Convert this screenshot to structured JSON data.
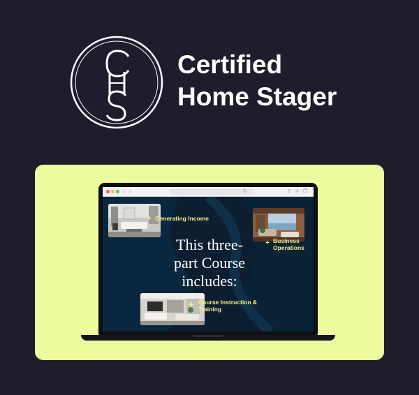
{
  "brand": {
    "logo_letters": "CHS",
    "title_line1": "Certified",
    "title_line2": "Home Stager"
  },
  "colors": {
    "page_background": "#1d1d2c",
    "card_background": "#eefc9f",
    "slide_background": "#0c1e30",
    "feature_text": "#f3f28a",
    "brand_text": "#ffffff"
  },
  "browser": {
    "back_icon": "chevron-left-icon",
    "forward_icon": "chevron-right-icon",
    "reload_icon": "reload-icon",
    "share_icon": "share-icon",
    "new_tab_icon": "plus-icon",
    "tabs_icon": "tabs-icon"
  },
  "slide": {
    "heading_line1": "This three-",
    "heading_line2": "part Course",
    "heading_line3": "includes:",
    "features": [
      {
        "label": "Generating Income"
      },
      {
        "label_line1": "Business",
        "label_line2": "Operations"
      },
      {
        "label_line1": "Course Instruction &",
        "label_line2": "Training"
      }
    ]
  }
}
